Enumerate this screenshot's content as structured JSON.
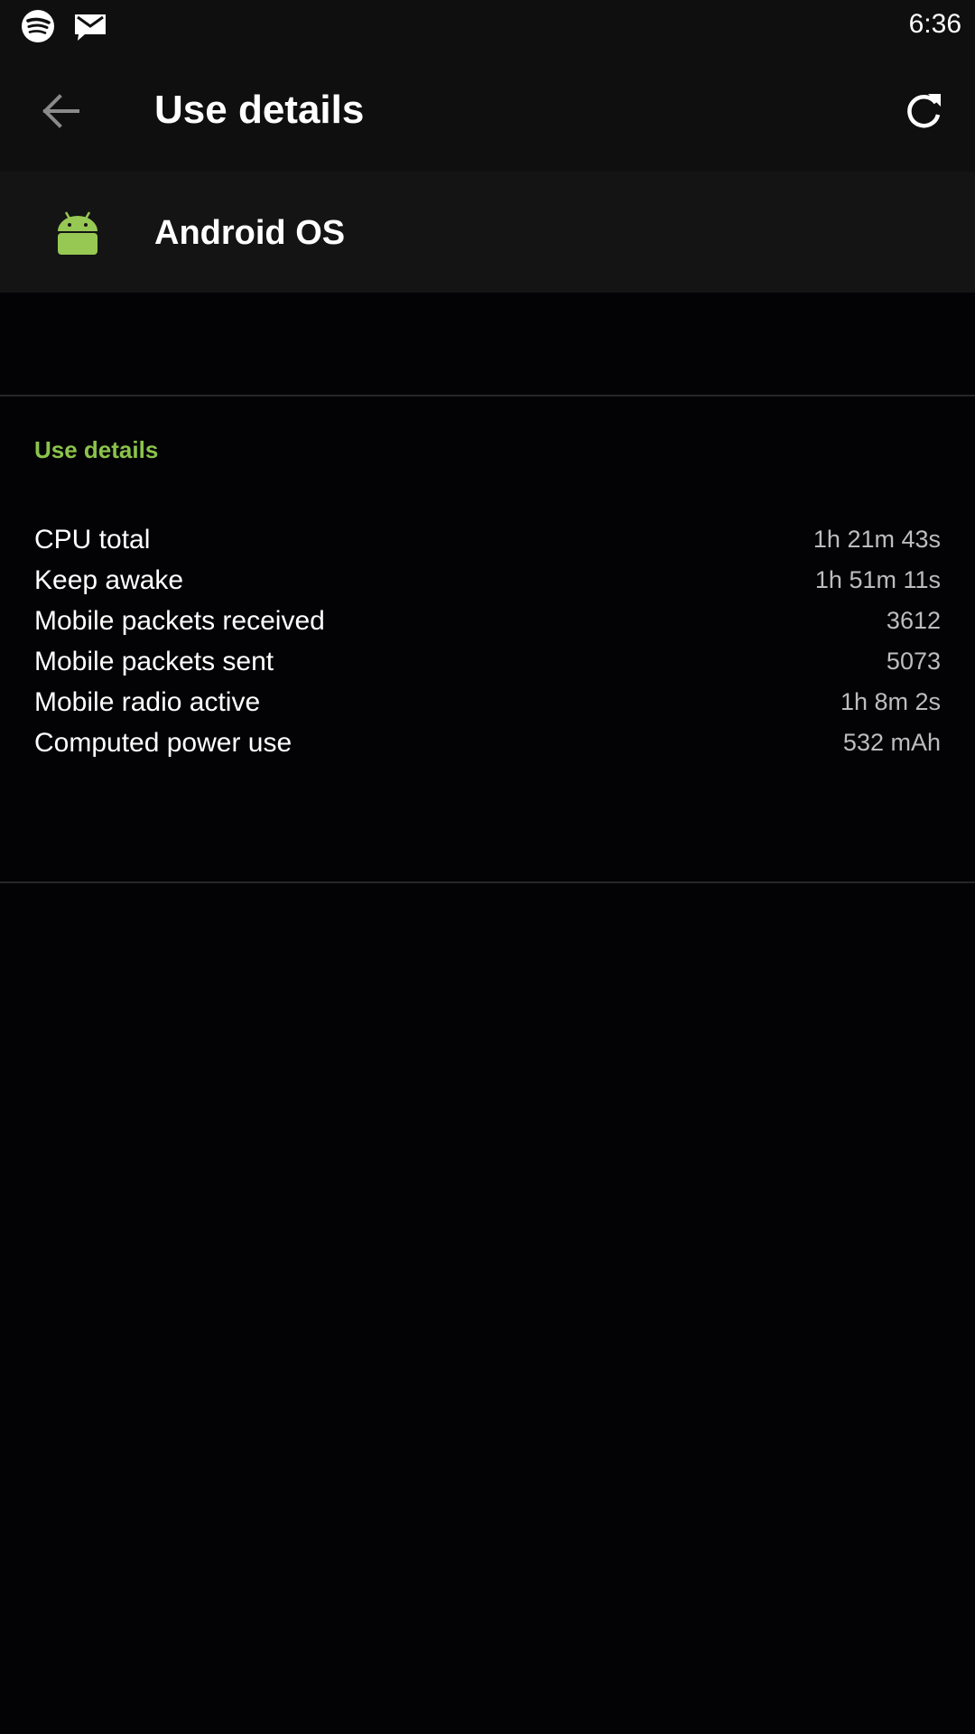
{
  "status_bar": {
    "time": "6:36",
    "icons": [
      "spotify-icon",
      "mail-icon"
    ]
  },
  "app_bar": {
    "title": "Use details",
    "back_icon": "arrow-back-icon",
    "refresh_icon": "refresh-icon"
  },
  "app": {
    "name": "Android OS",
    "icon": "android-icon"
  },
  "section": {
    "title": "Use details",
    "rows": [
      {
        "label": "CPU total",
        "value": "1h 21m 43s"
      },
      {
        "label": "Keep awake",
        "value": "1h 51m 11s"
      },
      {
        "label": "Mobile packets received",
        "value": "3612"
      },
      {
        "label": "Mobile packets sent",
        "value": "5073"
      },
      {
        "label": "Mobile radio active",
        "value": "1h 8m 2s"
      },
      {
        "label": "Computed power use",
        "value": "532 mAh"
      }
    ]
  },
  "colors": {
    "accent": "#8bc34a",
    "background": "#030205",
    "toolbar": "#0f0f0f",
    "app_header": "#141414"
  }
}
